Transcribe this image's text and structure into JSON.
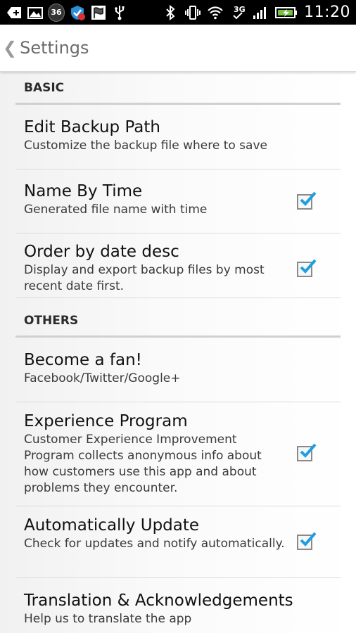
{
  "status_bar": {
    "badge": "36",
    "network": "3G",
    "time": "11:20",
    "icons": [
      "plus-icon",
      "image-icon",
      "badge-36-icon",
      "shield-ad-icon",
      "flag-icon",
      "usb-icon",
      "bluetooth-icon",
      "vibrate-icon",
      "wifi-icon",
      "network-3g-icon",
      "signal-icon",
      "battery-charging-icon"
    ]
  },
  "app_bar": {
    "title": "Settings"
  },
  "sections": [
    {
      "header": "BASIC"
    },
    {
      "header": "OTHERS"
    }
  ],
  "items": [
    {
      "title": "Edit Backup Path",
      "subtitle": "Customize the backup file where to save",
      "checked": false
    },
    {
      "title": "Name By Time",
      "subtitle": "Generated file name with time",
      "checked": true
    },
    {
      "title": "Order by date desc",
      "subtitle": "Display and export backup files by most recent date first.",
      "checked": true
    },
    {
      "title": "Become a fan!",
      "subtitle": "Facebook/Twitter/Google+",
      "checked": false
    },
    {
      "title": "Experience Program",
      "subtitle": "Customer Experience Improvement Program collects anonymous info about how customers use this app and about problems they encounter.",
      "checked": true
    },
    {
      "title": "Automatically Update",
      "subtitle": "Check for updates and notify automatically.",
      "checked": true
    },
    {
      "title": "Translation & Acknowledgements",
      "subtitle": "Help us to translate the app",
      "checked": false
    }
  ],
  "colors": {
    "check_blue": "#1e9fe0",
    "status_bar_bg": "#000000",
    "battery_green": "#76c043"
  }
}
